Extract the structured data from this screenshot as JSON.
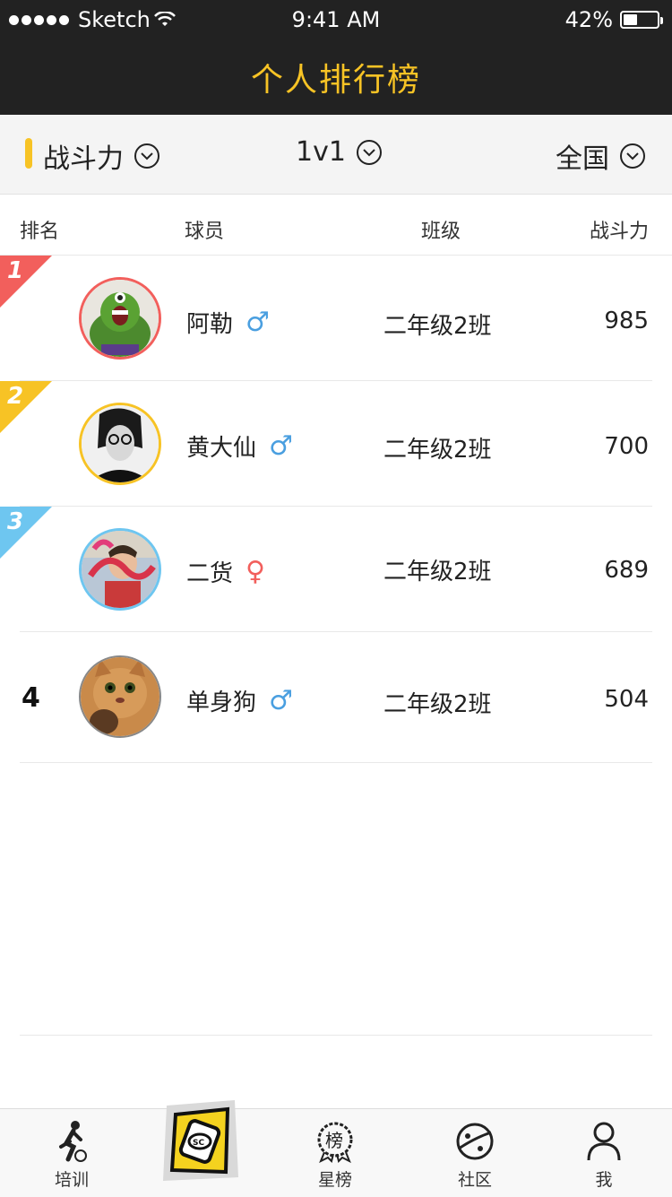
{
  "status_bar": {
    "carrier": "Sketch",
    "time": "9:41 AM",
    "battery": "42%",
    "battery_level": 0.42
  },
  "nav": {
    "title": "个人排行榜"
  },
  "filters": {
    "metric": "战斗力",
    "mode": "1v1",
    "region": "全国"
  },
  "table": {
    "headers": {
      "rank": "排名",
      "player": "球员",
      "class": "班级",
      "score": "战斗力"
    },
    "rows": [
      {
        "rank": "1",
        "name": "阿勒",
        "gender": "♂",
        "gender_color": "#4a9fe0",
        "class": "二年级2班",
        "score": "985",
        "ribbon_color": "#f25f5c",
        "avatar_border": "#f25f5c"
      },
      {
        "rank": "2",
        "name": "黄大仙",
        "gender": "♂",
        "gender_color": "#4a9fe0",
        "class": "二年级2班",
        "score": "700",
        "ribbon_color": "#f7c325",
        "avatar_border": "#f7c325"
      },
      {
        "rank": "3",
        "name": "二货",
        "gender": "♀",
        "gender_color": "#f25f5c",
        "class": "二年级2班",
        "score": "689",
        "ribbon_color": "#6ec6f0",
        "avatar_border": "#6ec6f0"
      },
      {
        "rank": "4",
        "name": "单身狗",
        "gender": "♂",
        "gender_color": "#4a9fe0",
        "class": "二年级2班",
        "score": "504",
        "ribbon_color": "",
        "avatar_border": "#888888"
      }
    ]
  },
  "tabbar": {
    "items": [
      {
        "label": "培训",
        "icon": "soccer-player-icon"
      },
      {
        "label": "",
        "icon": "app-logo-icon"
      },
      {
        "label": "星榜",
        "icon": "ranking-badge-icon"
      },
      {
        "label": "社区",
        "icon": "planet-icon"
      },
      {
        "label": "我",
        "icon": "person-icon"
      }
    ]
  },
  "colors": {
    "accent": "#f7c325",
    "dark_bar": "#222222"
  }
}
